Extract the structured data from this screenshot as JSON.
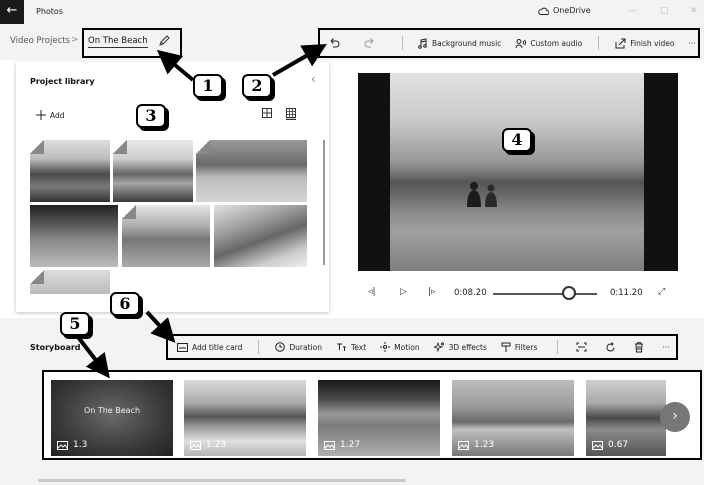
{
  "titlebar": {
    "back_icon": "arrow-left-icon",
    "app_title": "Photos",
    "onedrive_label": "OneDrive",
    "minimize": "—",
    "maximize": "□",
    "close": "✕"
  },
  "breadcrumb": {
    "root": "Video Projects",
    "separator": ">",
    "current": "On The Beach"
  },
  "toolbar": {
    "background_music": "Background music",
    "custom_audio": "Custom audio",
    "finish_video": "Finish video",
    "more": "···"
  },
  "library": {
    "title": "Project library",
    "add_label": "Add",
    "collapse": "‹"
  },
  "playback": {
    "current_time": "0:08.20",
    "end_time": "0:11.20",
    "progress_fraction": 0.73
  },
  "storyboard": {
    "title": "Storyboard",
    "actions": {
      "add_title_card": "Add title card",
      "duration": "Duration",
      "text": "Text",
      "motion": "Motion",
      "effects_3d": "3D effects",
      "filters": "Filters",
      "more": "···"
    },
    "clips": [
      {
        "label": "On The Beach",
        "duration": "1.3"
      },
      {
        "label": "",
        "duration": "1.23"
      },
      {
        "label": "",
        "duration": "1.27"
      },
      {
        "label": "",
        "duration": "1.23"
      },
      {
        "label": "",
        "duration": "0.67"
      }
    ],
    "next": "›"
  },
  "callouts": [
    "1",
    "2",
    "3",
    "4",
    "5",
    "6"
  ]
}
